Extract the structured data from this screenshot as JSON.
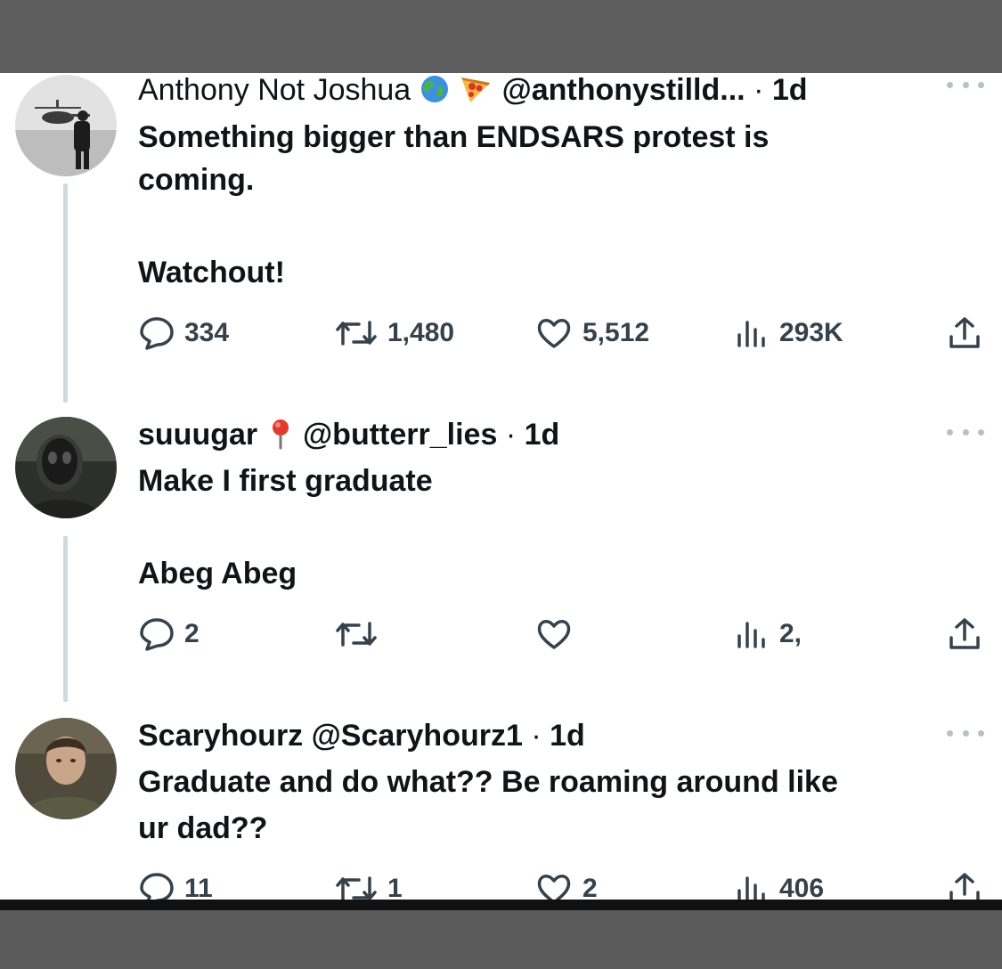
{
  "tweets": [
    {
      "name": "Anthony Not Joshua",
      "handle": "@anthonystilld...",
      "time": "1d",
      "lines": [
        "Something bigger than ENDSARS protest is",
        "coming.",
        "",
        "Watchout!"
      ],
      "replies": "334",
      "retweets": "1,480",
      "likes": "5,512",
      "views": "293K"
    },
    {
      "name": "suuugar",
      "handle": "@butterr_lies",
      "time": "1d",
      "lines": [
        "Make I first graduate",
        "",
        "Abeg Abeg"
      ],
      "replies": "2",
      "retweets": "",
      "likes": "",
      "views": "2,"
    },
    {
      "name": "Scaryhourz",
      "handle": "@Scaryhourz1",
      "time": "1d",
      "lines": [
        "Graduate and do what?? Be roaming around like",
        "ur dad??"
      ],
      "replies": "11",
      "retweets": "1",
      "likes": "2",
      "views": "406"
    }
  ],
  "separator": "·",
  "icons": {
    "reply": "speech-bubble-icon",
    "retweet": "retweet-arrows-icon",
    "like": "heart-icon",
    "views": "bar-chart-icon",
    "share": "share-upload-icon",
    "more": "more-dots-icon"
  },
  "colors": {
    "text": "#0f1419",
    "icon": "#36414b",
    "line": "#cfd9de",
    "background": "#ffffff"
  }
}
